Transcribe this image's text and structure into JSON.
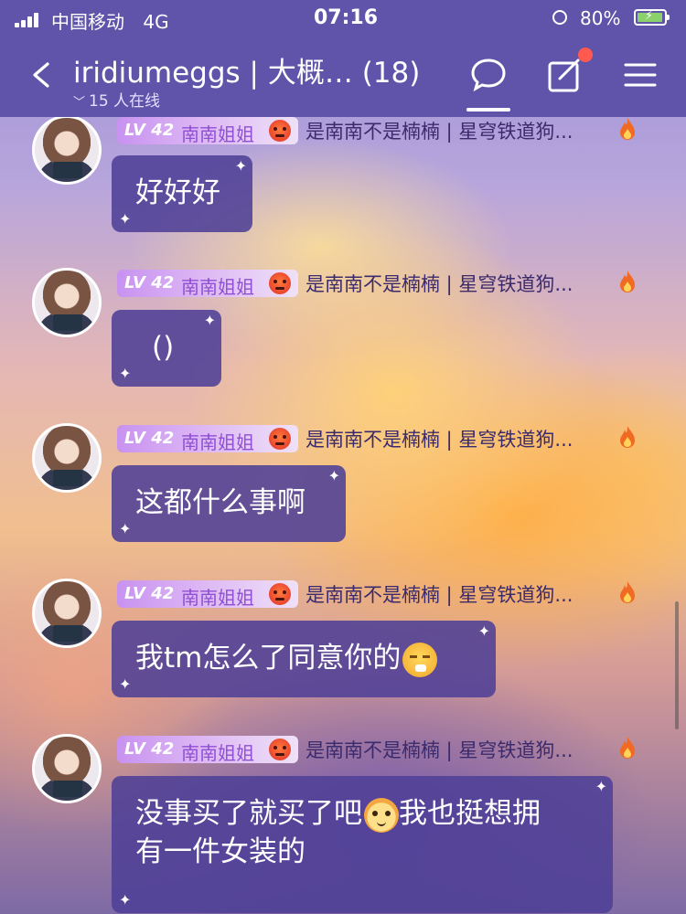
{
  "status_bar": {
    "carrier": "中国移动",
    "network": "4G",
    "time": "07:16",
    "battery_percent": "80%"
  },
  "header": {
    "title": "iridiumeggs | 大概… (18)",
    "online_text": "15 人在线",
    "icons": [
      "back-icon",
      "chat-icon",
      "edit-icon",
      "menu-icon"
    ],
    "accent_color": "#5f54a9",
    "notification_dot_color": "#ff5a50"
  },
  "messages": [
    {
      "level": "LV 42",
      "badge_title": "南南姐姐",
      "nickname": "是南南不是楠楠 | 星穹铁道狗...",
      "text": "好好好",
      "emoji": ""
    },
    {
      "level": "LV 42",
      "badge_title": "南南姐姐",
      "nickname": "是南南不是楠楠 | 星穹铁道狗...",
      "text": "()",
      "emoji": ""
    },
    {
      "level": "LV 42",
      "badge_title": "南南姐姐",
      "nickname": "是南南不是楠楠 | 星穹铁道狗...",
      "text": "这都什么事啊",
      "emoji": ""
    },
    {
      "level": "LV 42",
      "badge_title": "南南姐姐",
      "nickname": "是南南不是楠楠 | 星穹铁道狗...",
      "text": "我tm怎么了同意你的",
      "emoji": "sneeze-emoji"
    },
    {
      "level": "LV 42",
      "badge_title": "南南姐姐",
      "nickname": "是南南不是楠楠 | 星穹铁道狗...",
      "text_before": "没事买了就买了吧",
      "text_after_line1": "我也挺想拥",
      "text_line2": "有一件女装的",
      "emoji": "cat-emoji"
    }
  ]
}
